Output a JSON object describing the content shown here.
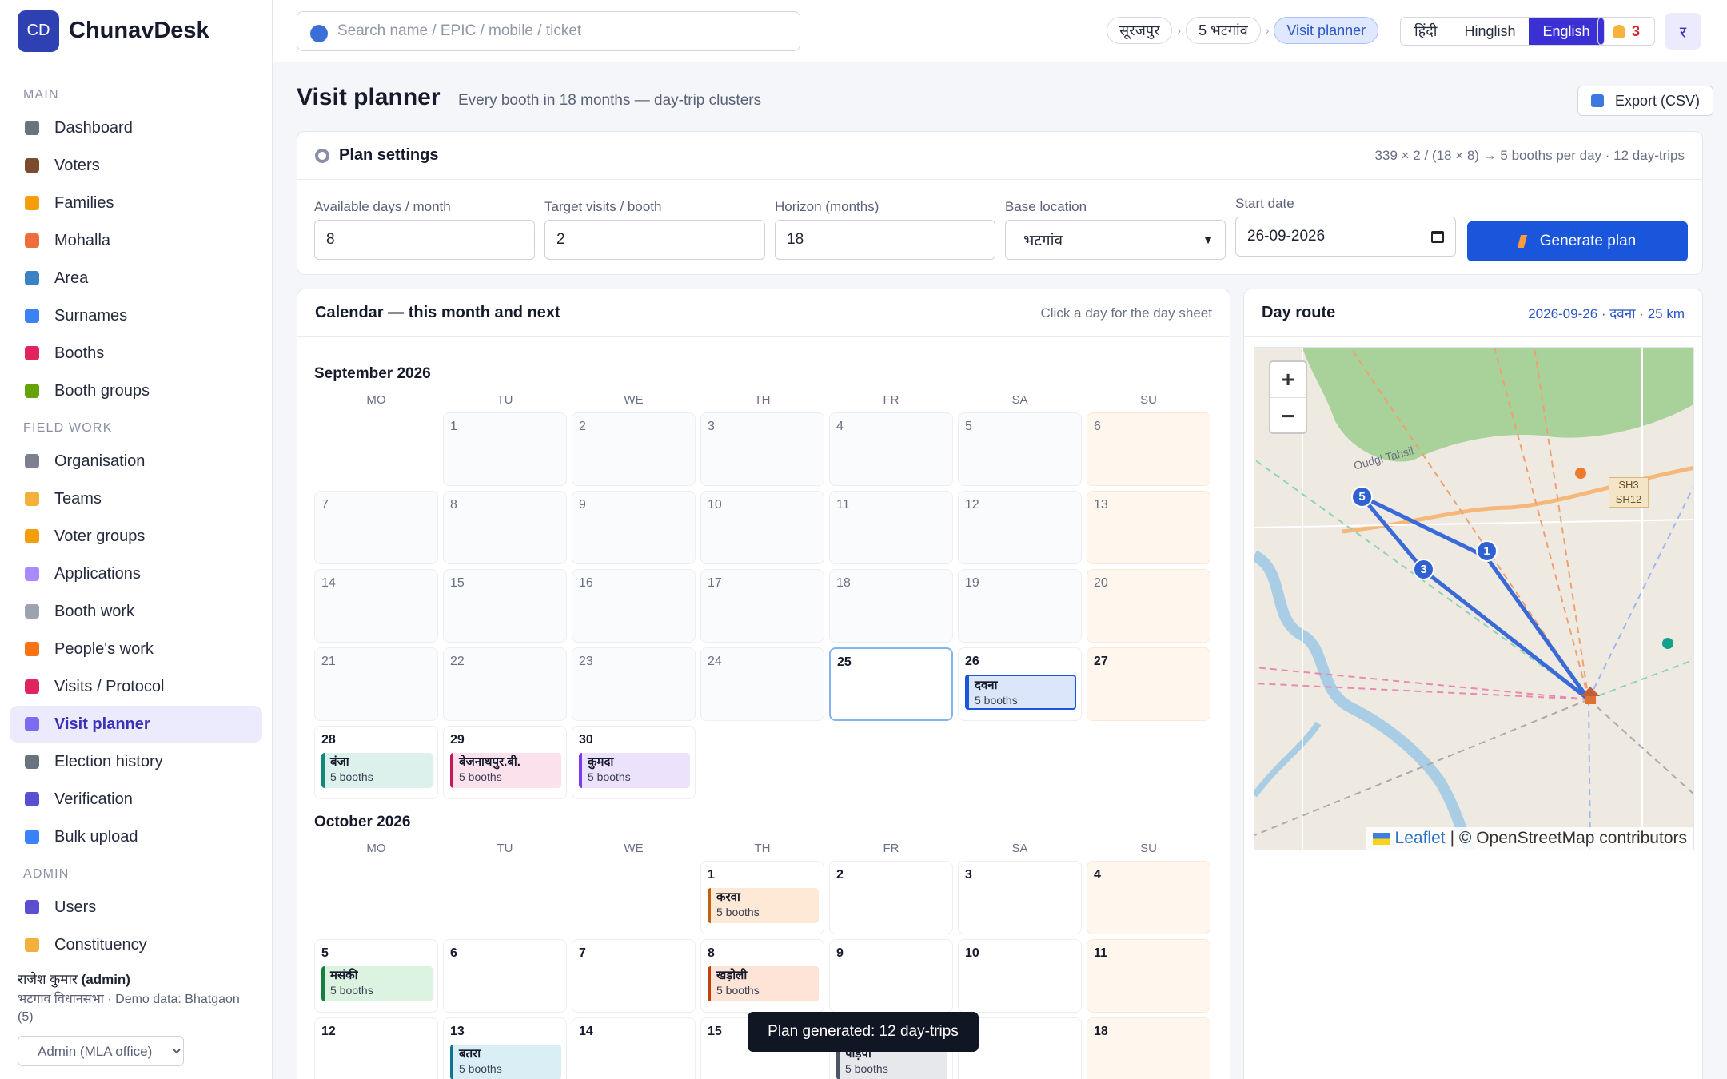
{
  "brand": {
    "logo": "CD",
    "name": "ChunavDesk"
  },
  "search": {
    "placeholder": "Search name / EPIC / mobile / ticket"
  },
  "breadcrumb": [
    "सूरजपुर",
    "5 भटगांव",
    "Visit planner"
  ],
  "languages": [
    {
      "label": "हिंदी",
      "active": false
    },
    {
      "label": "Hinglish",
      "active": false
    },
    {
      "label": "English",
      "active": true
    }
  ],
  "notifications": {
    "count": "3"
  },
  "user_avatar": "र",
  "nav": {
    "main_label": "MAIN",
    "main": [
      {
        "label": "Dashboard",
        "icon": "grid-icon",
        "color": "#6b7280"
      },
      {
        "label": "Voters",
        "icon": "person-icon",
        "color": "#7c4a2d"
      },
      {
        "label": "Families",
        "icon": "family-icon",
        "color": "#f59e0b"
      },
      {
        "label": "Mohalla",
        "icon": "house-icon",
        "color": "#ef6c3d"
      },
      {
        "label": "Area",
        "icon": "map-icon",
        "color": "#3b82c4"
      },
      {
        "label": "Surnames",
        "icon": "abc-icon",
        "color": "#3b82f6"
      },
      {
        "label": "Booths",
        "icon": "pin-icon",
        "color": "#e0245e"
      },
      {
        "label": "Booth groups",
        "icon": "puzzle-icon",
        "color": "#65a30d"
      }
    ],
    "field_label": "FIELD WORK",
    "field": [
      {
        "label": "Organisation",
        "icon": "building-icon",
        "color": "#7c7f8e"
      },
      {
        "label": "Teams",
        "icon": "handshake-icon",
        "color": "#f2b13a"
      },
      {
        "label": "Voter groups",
        "icon": "tag-icon",
        "color": "#f59e0b"
      },
      {
        "label": "Applications",
        "icon": "inbox-icon",
        "color": "#a78bfa"
      },
      {
        "label": "Booth work",
        "icon": "tools-icon",
        "color": "#9ca3af"
      },
      {
        "label": "People's work",
        "icon": "hand-icon",
        "color": "#f97316"
      },
      {
        "label": "Visits / Protocol",
        "icon": "car-icon",
        "color": "#e0245e"
      },
      {
        "label": "Visit planner",
        "icon": "calendar-icon",
        "color": "#7c6cf0",
        "active": true
      },
      {
        "label": "Election history",
        "icon": "archive-icon",
        "color": "#6b7280"
      },
      {
        "label": "Verification",
        "icon": "check-icon",
        "color": "#5b4fd0"
      },
      {
        "label": "Bulk upload",
        "icon": "upload-icon",
        "color": "#3b82f6"
      }
    ],
    "admin_label": "ADMIN",
    "admin": [
      {
        "label": "Users",
        "icon": "users-icon",
        "color": "#5b4fd0"
      },
      {
        "label": "Constituency",
        "icon": "gear-icon",
        "color": "#f2b13a"
      }
    ]
  },
  "footer": {
    "user": "राजेश कुमार",
    "role": "(admin)",
    "context": "भटगांव विधानसभा · Demo data: Bhatgaon (5)",
    "role_select": "Admin (MLA office)"
  },
  "page": {
    "title": "Visit planner",
    "subtitle": "Every booth in 18 months — day-trip clusters",
    "export_label": "Export (CSV)"
  },
  "settings": {
    "title": "Plan settings",
    "formula": "339 × 2 / (18 × 8) → 5 booths per day · 12 day-trips",
    "fields": [
      {
        "label": "Available days / month",
        "value": "8"
      },
      {
        "label": "Target visits / booth",
        "value": "2"
      },
      {
        "label": "Horizon (months)",
        "value": "18"
      },
      {
        "label": "Base location",
        "value": "भटगांव"
      },
      {
        "label": "Start date",
        "value": "26-09-2026"
      }
    ],
    "generate_label": "Generate plan"
  },
  "calendar": {
    "title": "Calendar — this month and next",
    "hint": "Click a day for the day sheet",
    "weekdays": [
      "MO",
      "TU",
      "WE",
      "TH",
      "FR",
      "SA",
      "SU"
    ],
    "months": [
      {
        "name": "September 2026",
        "offset": 1,
        "days": 30,
        "current_from": 25,
        "today": 25,
        "trips": {
          "26": {
            "name": "दवना",
            "booths": "5 booths",
            "selected": true
          },
          "28": {
            "name": "बंजा",
            "booths": "5 booths"
          },
          "29": {
            "name": "बेजनाथपुर.बी.",
            "booths": "5 booths"
          },
          "30": {
            "name": "कुमदा",
            "booths": "5 booths"
          }
        }
      },
      {
        "name": "October 2026",
        "offset": 3,
        "days": 18,
        "current_from": 1,
        "today": 0,
        "trips": {
          "1": {
            "name": "करवा",
            "booths": "5 booths"
          },
          "5": {
            "name": "मसंकी",
            "booths": "5 booths"
          },
          "8": {
            "name": "खड़ोली",
            "booths": "5 booths"
          },
          "13": {
            "name": "बतरा",
            "booths": "5 booths"
          },
          "16": {
            "name": "पाड़पा",
            "booths": "5 booths"
          }
        }
      }
    ]
  },
  "trip_colors": {
    "दवना": "#1a56db",
    "बंजा": "#0f8a7a",
    "बेजनाथपुर.बी.": "#c2185b",
    "कुमदा": "#7c3aed",
    "करवा": "#c2620c",
    "मसंकी": "#15803d",
    "खड़ोली": "#c2410c",
    "बतरा": "#0e7490",
    "पाड़पा": "#4b5563"
  },
  "trip_bg": {
    "दवना": "#dbe6fb",
    "बंजा": "#dcf0ec",
    "बेजनाथपुर.बी.": "#fbe1ec",
    "कुमदा": "#ece2fb",
    "करवा": "#fde9d6",
    "मसंकी": "#ddf3e2",
    "खड़ोली": "#fde4d6",
    "बतरा": "#d9eef5",
    "पाड़पा": "#e6e8ec"
  },
  "route": {
    "title": "Day route",
    "summary": "2026-09-26 · दवना · 25 km",
    "stops": [
      "5",
      "3",
      "1"
    ],
    "map_labels": [
      "Oudgi Tahsil",
      "SH3",
      "SH12"
    ],
    "attribution_link": "Leaflet",
    "attribution_text": "| © OpenStreetMap contributors"
  },
  "toast": "Plan generated: 12 day-trips"
}
